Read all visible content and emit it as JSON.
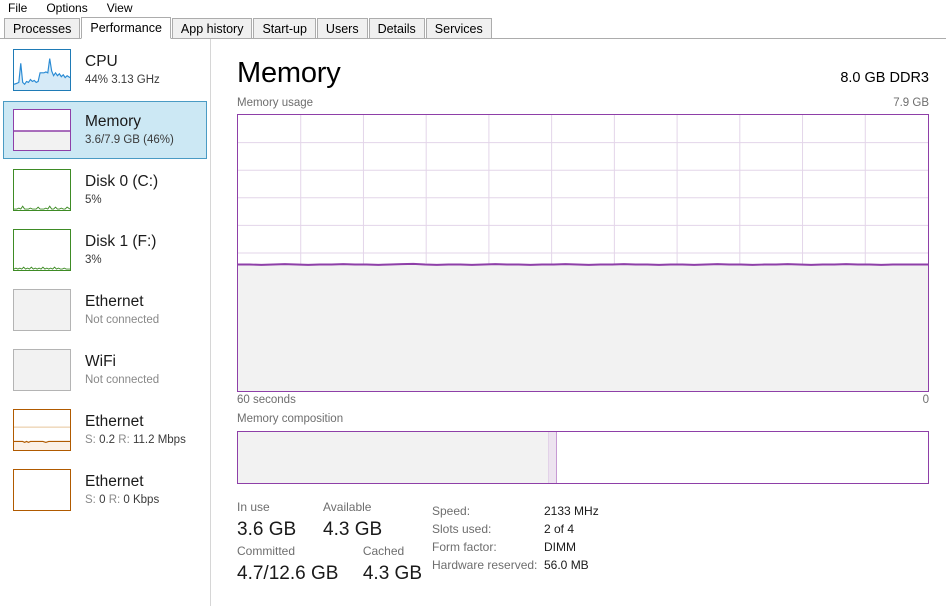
{
  "menu": {
    "items": [
      {
        "label": "File",
        "name": "menu-file"
      },
      {
        "label": "Options",
        "name": "menu-options"
      },
      {
        "label": "View",
        "name": "menu-view"
      }
    ]
  },
  "tabs": [
    {
      "label": "Processes",
      "active": false
    },
    {
      "label": "Performance",
      "active": true
    },
    {
      "label": "App history",
      "active": false
    },
    {
      "label": "Start-up",
      "active": false
    },
    {
      "label": "Users",
      "active": false
    },
    {
      "label": "Details",
      "active": false
    },
    {
      "label": "Services",
      "active": false
    }
  ],
  "sidebar": {
    "items": [
      {
        "title": "CPU",
        "sub": "44% 3.13 GHz",
        "color": "#1F7BB6",
        "selected": false,
        "connected": true
      },
      {
        "title": "Memory",
        "sub": "3.6/7.9 GB (46%)",
        "color": "#8E3FA8",
        "selected": true,
        "connected": true
      },
      {
        "title": "Disk 0 (C:)",
        "sub": "5%",
        "color": "#3E8B25",
        "selected": false,
        "connected": true
      },
      {
        "title": "Disk 1 (F:)",
        "sub": "3%",
        "color": "#3E8B25",
        "selected": false,
        "connected": true
      },
      {
        "title": "Ethernet",
        "sub": "Not connected",
        "color": "#B4B4B4",
        "selected": false,
        "connected": false
      },
      {
        "title": "WiFi",
        "sub": "Not connected",
        "color": "#B4B4B4",
        "selected": false,
        "connected": false
      },
      {
        "title": "Ethernet",
        "sub_s_label": "S:",
        "sub_s_value": "0.2",
        "sub_r_label": "R:",
        "sub_r_value": "11.2 Mbps",
        "color": "#B05A00",
        "selected": false,
        "connected": true
      },
      {
        "title": "Ethernet",
        "sub_s_label": "S:",
        "sub_s_value": "0",
        "sub_r_label": "R:",
        "sub_r_value": "0 Kbps",
        "color": "#B05A00",
        "selected": false,
        "connected": true
      }
    ]
  },
  "main": {
    "title": "Memory",
    "hardware": "8.0 GB DDR3",
    "graph_caption": "Memory usage",
    "graph_max": "7.9 GB",
    "axis_left": "60 seconds",
    "axis_right": "0",
    "composition_caption": "Memory composition",
    "accent_color": "#8E3FA8"
  },
  "chart_data": {
    "type": "area",
    "title": "Memory usage",
    "ylabel": "7.9 GB",
    "xlabel": "60 seconds",
    "ylim": [
      0,
      7.9
    ],
    "xlim": [
      60,
      0
    ],
    "grid": true,
    "grid_columns": 11,
    "grid_rows": 10,
    "series": [
      {
        "name": "In use memory",
        "color": "#8E3FA8",
        "fill": "#F2F2F2",
        "unit": "GB",
        "values": [
          3.62,
          3.62,
          3.61,
          3.62,
          3.63,
          3.62,
          3.61,
          3.62,
          3.62,
          3.63,
          3.62,
          3.62,
          3.61,
          3.62,
          3.63,
          3.64,
          3.62,
          3.61,
          3.62,
          3.62,
          3.61,
          3.62,
          3.63,
          3.62,
          3.62,
          3.61,
          3.62,
          3.62,
          3.63,
          3.62,
          3.61,
          3.62,
          3.62,
          3.63,
          3.62,
          3.62,
          3.61,
          3.62,
          3.62,
          3.61,
          3.62,
          3.63,
          3.62,
          3.62,
          3.61,
          3.62,
          3.62,
          3.63,
          3.62,
          3.61,
          3.62,
          3.62,
          3.63,
          3.62,
          3.62,
          3.61,
          3.62,
          3.62,
          3.62,
          3.62
        ]
      }
    ]
  },
  "composition": {
    "in_use_percent": 45,
    "separator_percent": 1.3,
    "available_percent": 53.7
  },
  "stats": {
    "left": [
      {
        "label": "In use",
        "value": "3.6 GB"
      },
      {
        "label": "Available",
        "value": "4.3 GB"
      },
      {
        "label": "Committed",
        "value": "4.7/12.6 GB"
      },
      {
        "label": "Cached",
        "value": "4.3 GB"
      }
    ],
    "right": [
      {
        "key": "Speed:",
        "value": "2133 MHz"
      },
      {
        "key": "Slots used:",
        "value": "2 of 4"
      },
      {
        "key": "Form factor:",
        "value": "DIMM"
      },
      {
        "key": "Hardware reserved:",
        "value": "56.0 MB"
      }
    ]
  }
}
